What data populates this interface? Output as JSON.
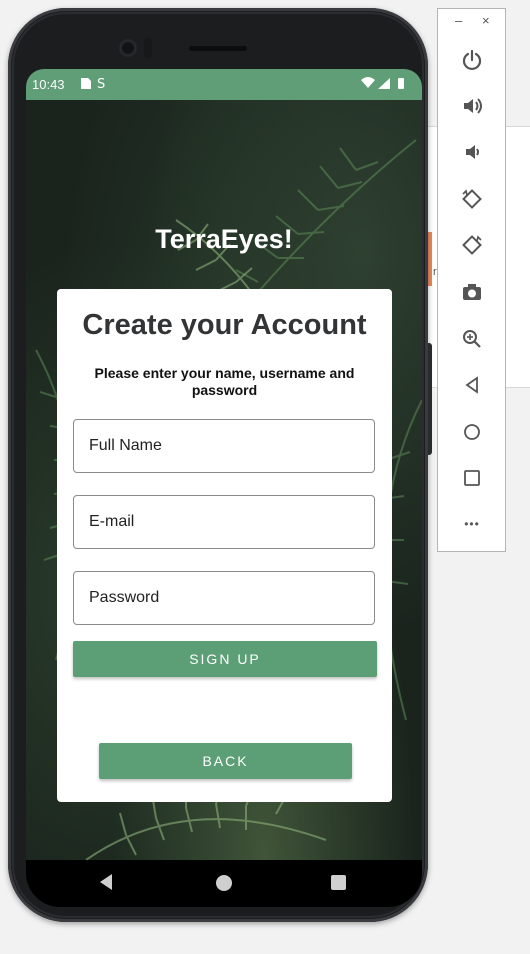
{
  "status_bar": {
    "time": "10:43",
    "left_icons": "▪ ⌘",
    "right_icons": "▾◢▮"
  },
  "app": {
    "title": "TerraEyes!",
    "card": {
      "title": "Create your Account",
      "subtitle": "Please enter your name, username and password",
      "fields": {
        "full_name_placeholder": "Full Name",
        "email_placeholder": "E-mail",
        "password_placeholder": "Password"
      },
      "sign_up_label": "SIGN UP",
      "back_label": "BACK"
    }
  },
  "colors": {
    "accent_green": "#5c9e76",
    "status_bar": "#5f9e76"
  },
  "emulator_toolbar": {
    "window_controls": {
      "minimize": "–",
      "close": "×"
    },
    "buttons": [
      "power-icon",
      "volume-up-icon",
      "volume-down-icon",
      "rotate-left-icon",
      "rotate-right-icon",
      "camera-icon",
      "zoom-in-icon",
      "back-icon",
      "home-icon",
      "overview-icon",
      "more-icon"
    ],
    "more_label": "•••"
  },
  "nav_bar": {
    "items": [
      "back-icon",
      "home-icon",
      "recents-icon"
    ]
  }
}
